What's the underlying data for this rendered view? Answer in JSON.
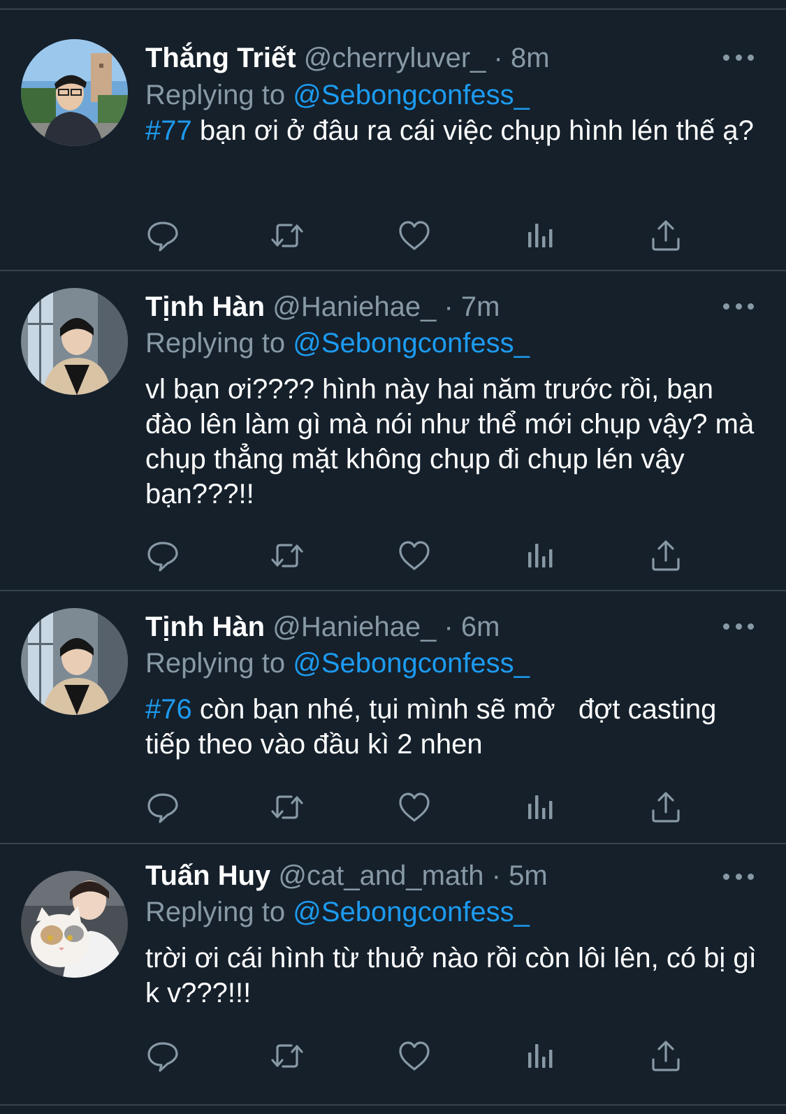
{
  "replying_label": "Replying to",
  "tweets": [
    {
      "name": "Thắng Triết",
      "handle": "@cherryluver_",
      "separator": "·",
      "time": "8m",
      "replying_to": "@Sebongconfess_",
      "hashtag": "#77",
      "text": " bạn ơi ở đâu ra cái việc chụp hình lén thế ạ?"
    },
    {
      "name": "Tịnh Hàn",
      "handle": "@Haniehae_",
      "separator": "·",
      "time": "7m",
      "replying_to": "@Sebongconfess_",
      "hashtag": "",
      "text": "vl bạn ơi???? hình này hai năm trước rồi, bạn đào lên làm gì mà nói như thể mới chụp vậy? mà chụp thẳng mặt không chụp đi chụp lén vậy bạn???!!"
    },
    {
      "name": "Tịnh Hàn",
      "handle": "@Haniehae_",
      "separator": "·",
      "time": "6m",
      "replying_to": "@Sebongconfess_",
      "hashtag": "#76",
      "text": " còn bạn nhé, tụi mình sẽ mở   đợt casting tiếp theo vào đầu kì 2 nhen"
    },
    {
      "name": "Tuấn Huy",
      "handle": "@cat_and_math",
      "separator": "·",
      "time": "5m",
      "replying_to": "@Sebongconfess_",
      "hashtag": "",
      "text": "trời ơi cái hình từ thuở nào rồi còn lôi lên, có bị gì k v???!!!"
    }
  ],
  "action_icons": [
    "reply-icon",
    "retweet-icon",
    "like-icon",
    "analytics-icon",
    "share-icon"
  ],
  "colors": {
    "background": "#15202b",
    "divider": "#38444d",
    "text": "#ffffff",
    "secondary": "#8899a6",
    "accent": "#1d9bf0"
  }
}
